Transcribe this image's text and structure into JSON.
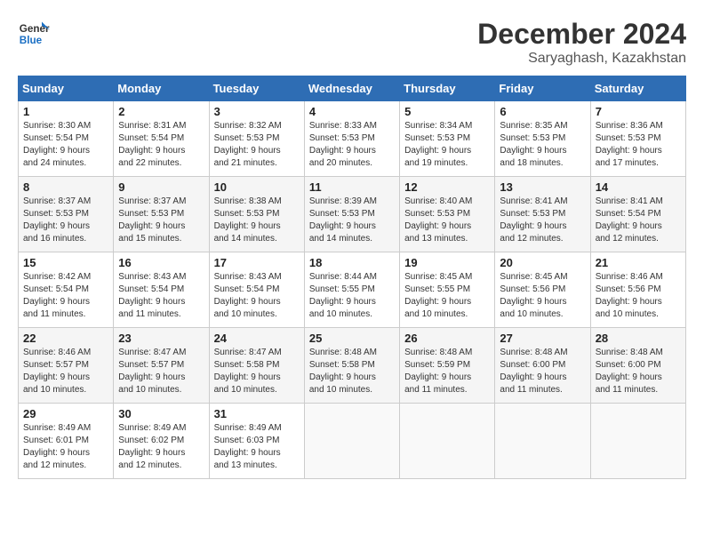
{
  "header": {
    "logo": {
      "line1": "General",
      "line2": "Blue"
    },
    "month": "December 2024",
    "location": "Saryaghash, Kazakhstan"
  },
  "columns": [
    "Sunday",
    "Monday",
    "Tuesday",
    "Wednesday",
    "Thursday",
    "Friday",
    "Saturday"
  ],
  "weeks": [
    [
      {
        "day": "1",
        "info": "Sunrise: 8:30 AM\nSunset: 5:54 PM\nDaylight: 9 hours\nand 24 minutes."
      },
      {
        "day": "2",
        "info": "Sunrise: 8:31 AM\nSunset: 5:54 PM\nDaylight: 9 hours\nand 22 minutes."
      },
      {
        "day": "3",
        "info": "Sunrise: 8:32 AM\nSunset: 5:53 PM\nDaylight: 9 hours\nand 21 minutes."
      },
      {
        "day": "4",
        "info": "Sunrise: 8:33 AM\nSunset: 5:53 PM\nDaylight: 9 hours\nand 20 minutes."
      },
      {
        "day": "5",
        "info": "Sunrise: 8:34 AM\nSunset: 5:53 PM\nDaylight: 9 hours\nand 19 minutes."
      },
      {
        "day": "6",
        "info": "Sunrise: 8:35 AM\nSunset: 5:53 PM\nDaylight: 9 hours\nand 18 minutes."
      },
      {
        "day": "7",
        "info": "Sunrise: 8:36 AM\nSunset: 5:53 PM\nDaylight: 9 hours\nand 17 minutes."
      }
    ],
    [
      {
        "day": "8",
        "info": "Sunrise: 8:37 AM\nSunset: 5:53 PM\nDaylight: 9 hours\nand 16 minutes."
      },
      {
        "day": "9",
        "info": "Sunrise: 8:37 AM\nSunset: 5:53 PM\nDaylight: 9 hours\nand 15 minutes."
      },
      {
        "day": "10",
        "info": "Sunrise: 8:38 AM\nSunset: 5:53 PM\nDaylight: 9 hours\nand 14 minutes."
      },
      {
        "day": "11",
        "info": "Sunrise: 8:39 AM\nSunset: 5:53 PM\nDaylight: 9 hours\nand 14 minutes."
      },
      {
        "day": "12",
        "info": "Sunrise: 8:40 AM\nSunset: 5:53 PM\nDaylight: 9 hours\nand 13 minutes."
      },
      {
        "day": "13",
        "info": "Sunrise: 8:41 AM\nSunset: 5:53 PM\nDaylight: 9 hours\nand 12 minutes."
      },
      {
        "day": "14",
        "info": "Sunrise: 8:41 AM\nSunset: 5:54 PM\nDaylight: 9 hours\nand 12 minutes."
      }
    ],
    [
      {
        "day": "15",
        "info": "Sunrise: 8:42 AM\nSunset: 5:54 PM\nDaylight: 9 hours\nand 11 minutes."
      },
      {
        "day": "16",
        "info": "Sunrise: 8:43 AM\nSunset: 5:54 PM\nDaylight: 9 hours\nand 11 minutes."
      },
      {
        "day": "17",
        "info": "Sunrise: 8:43 AM\nSunset: 5:54 PM\nDaylight: 9 hours\nand 10 minutes."
      },
      {
        "day": "18",
        "info": "Sunrise: 8:44 AM\nSunset: 5:55 PM\nDaylight: 9 hours\nand 10 minutes."
      },
      {
        "day": "19",
        "info": "Sunrise: 8:45 AM\nSunset: 5:55 PM\nDaylight: 9 hours\nand 10 minutes."
      },
      {
        "day": "20",
        "info": "Sunrise: 8:45 AM\nSunset: 5:56 PM\nDaylight: 9 hours\nand 10 minutes."
      },
      {
        "day": "21",
        "info": "Sunrise: 8:46 AM\nSunset: 5:56 PM\nDaylight: 9 hours\nand 10 minutes."
      }
    ],
    [
      {
        "day": "22",
        "info": "Sunrise: 8:46 AM\nSunset: 5:57 PM\nDaylight: 9 hours\nand 10 minutes."
      },
      {
        "day": "23",
        "info": "Sunrise: 8:47 AM\nSunset: 5:57 PM\nDaylight: 9 hours\nand 10 minutes."
      },
      {
        "day": "24",
        "info": "Sunrise: 8:47 AM\nSunset: 5:58 PM\nDaylight: 9 hours\nand 10 minutes."
      },
      {
        "day": "25",
        "info": "Sunrise: 8:48 AM\nSunset: 5:58 PM\nDaylight: 9 hours\nand 10 minutes."
      },
      {
        "day": "26",
        "info": "Sunrise: 8:48 AM\nSunset: 5:59 PM\nDaylight: 9 hours\nand 11 minutes."
      },
      {
        "day": "27",
        "info": "Sunrise: 8:48 AM\nSunset: 6:00 PM\nDaylight: 9 hours\nand 11 minutes."
      },
      {
        "day": "28",
        "info": "Sunrise: 8:48 AM\nSunset: 6:00 PM\nDaylight: 9 hours\nand 11 minutes."
      }
    ],
    [
      {
        "day": "29",
        "info": "Sunrise: 8:49 AM\nSunset: 6:01 PM\nDaylight: 9 hours\nand 12 minutes."
      },
      {
        "day": "30",
        "info": "Sunrise: 8:49 AM\nSunset: 6:02 PM\nDaylight: 9 hours\nand 12 minutes."
      },
      {
        "day": "31",
        "info": "Sunrise: 8:49 AM\nSunset: 6:03 PM\nDaylight: 9 hours\nand 13 minutes."
      },
      null,
      null,
      null,
      null
    ]
  ]
}
